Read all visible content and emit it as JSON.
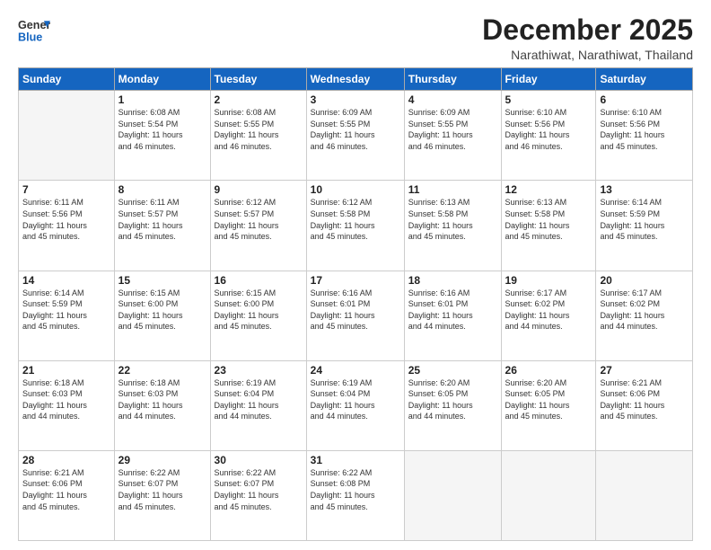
{
  "header": {
    "logo_general": "General",
    "logo_blue": "Blue",
    "title": "December 2025",
    "subtitle": "Narathiwat, Narathiwat, Thailand"
  },
  "weekdays": [
    "Sunday",
    "Monday",
    "Tuesday",
    "Wednesday",
    "Thursday",
    "Friday",
    "Saturday"
  ],
  "weeks": [
    [
      {
        "day": "",
        "info": ""
      },
      {
        "day": "1",
        "info": "Sunrise: 6:08 AM\nSunset: 5:54 PM\nDaylight: 11 hours\nand 46 minutes."
      },
      {
        "day": "2",
        "info": "Sunrise: 6:08 AM\nSunset: 5:55 PM\nDaylight: 11 hours\nand 46 minutes."
      },
      {
        "day": "3",
        "info": "Sunrise: 6:09 AM\nSunset: 5:55 PM\nDaylight: 11 hours\nand 46 minutes."
      },
      {
        "day": "4",
        "info": "Sunrise: 6:09 AM\nSunset: 5:55 PM\nDaylight: 11 hours\nand 46 minutes."
      },
      {
        "day": "5",
        "info": "Sunrise: 6:10 AM\nSunset: 5:56 PM\nDaylight: 11 hours\nand 46 minutes."
      },
      {
        "day": "6",
        "info": "Sunrise: 6:10 AM\nSunset: 5:56 PM\nDaylight: 11 hours\nand 45 minutes."
      }
    ],
    [
      {
        "day": "7",
        "info": "Sunrise: 6:11 AM\nSunset: 5:56 PM\nDaylight: 11 hours\nand 45 minutes."
      },
      {
        "day": "8",
        "info": "Sunrise: 6:11 AM\nSunset: 5:57 PM\nDaylight: 11 hours\nand 45 minutes."
      },
      {
        "day": "9",
        "info": "Sunrise: 6:12 AM\nSunset: 5:57 PM\nDaylight: 11 hours\nand 45 minutes."
      },
      {
        "day": "10",
        "info": "Sunrise: 6:12 AM\nSunset: 5:58 PM\nDaylight: 11 hours\nand 45 minutes."
      },
      {
        "day": "11",
        "info": "Sunrise: 6:13 AM\nSunset: 5:58 PM\nDaylight: 11 hours\nand 45 minutes."
      },
      {
        "day": "12",
        "info": "Sunrise: 6:13 AM\nSunset: 5:58 PM\nDaylight: 11 hours\nand 45 minutes."
      },
      {
        "day": "13",
        "info": "Sunrise: 6:14 AM\nSunset: 5:59 PM\nDaylight: 11 hours\nand 45 minutes."
      }
    ],
    [
      {
        "day": "14",
        "info": "Sunrise: 6:14 AM\nSunset: 5:59 PM\nDaylight: 11 hours\nand 45 minutes."
      },
      {
        "day": "15",
        "info": "Sunrise: 6:15 AM\nSunset: 6:00 PM\nDaylight: 11 hours\nand 45 minutes."
      },
      {
        "day": "16",
        "info": "Sunrise: 6:15 AM\nSunset: 6:00 PM\nDaylight: 11 hours\nand 45 minutes."
      },
      {
        "day": "17",
        "info": "Sunrise: 6:16 AM\nSunset: 6:01 PM\nDaylight: 11 hours\nand 45 minutes."
      },
      {
        "day": "18",
        "info": "Sunrise: 6:16 AM\nSunset: 6:01 PM\nDaylight: 11 hours\nand 44 minutes."
      },
      {
        "day": "19",
        "info": "Sunrise: 6:17 AM\nSunset: 6:02 PM\nDaylight: 11 hours\nand 44 minutes."
      },
      {
        "day": "20",
        "info": "Sunrise: 6:17 AM\nSunset: 6:02 PM\nDaylight: 11 hours\nand 44 minutes."
      }
    ],
    [
      {
        "day": "21",
        "info": "Sunrise: 6:18 AM\nSunset: 6:03 PM\nDaylight: 11 hours\nand 44 minutes."
      },
      {
        "day": "22",
        "info": "Sunrise: 6:18 AM\nSunset: 6:03 PM\nDaylight: 11 hours\nand 44 minutes."
      },
      {
        "day": "23",
        "info": "Sunrise: 6:19 AM\nSunset: 6:04 PM\nDaylight: 11 hours\nand 44 minutes."
      },
      {
        "day": "24",
        "info": "Sunrise: 6:19 AM\nSunset: 6:04 PM\nDaylight: 11 hours\nand 44 minutes."
      },
      {
        "day": "25",
        "info": "Sunrise: 6:20 AM\nSunset: 6:05 PM\nDaylight: 11 hours\nand 44 minutes."
      },
      {
        "day": "26",
        "info": "Sunrise: 6:20 AM\nSunset: 6:05 PM\nDaylight: 11 hours\nand 45 minutes."
      },
      {
        "day": "27",
        "info": "Sunrise: 6:21 AM\nSunset: 6:06 PM\nDaylight: 11 hours\nand 45 minutes."
      }
    ],
    [
      {
        "day": "28",
        "info": "Sunrise: 6:21 AM\nSunset: 6:06 PM\nDaylight: 11 hours\nand 45 minutes."
      },
      {
        "day": "29",
        "info": "Sunrise: 6:22 AM\nSunset: 6:07 PM\nDaylight: 11 hours\nand 45 minutes."
      },
      {
        "day": "30",
        "info": "Sunrise: 6:22 AM\nSunset: 6:07 PM\nDaylight: 11 hours\nand 45 minutes."
      },
      {
        "day": "31",
        "info": "Sunrise: 6:22 AM\nSunset: 6:08 PM\nDaylight: 11 hours\nand 45 minutes."
      },
      {
        "day": "",
        "info": ""
      },
      {
        "day": "",
        "info": ""
      },
      {
        "day": "",
        "info": ""
      }
    ]
  ]
}
